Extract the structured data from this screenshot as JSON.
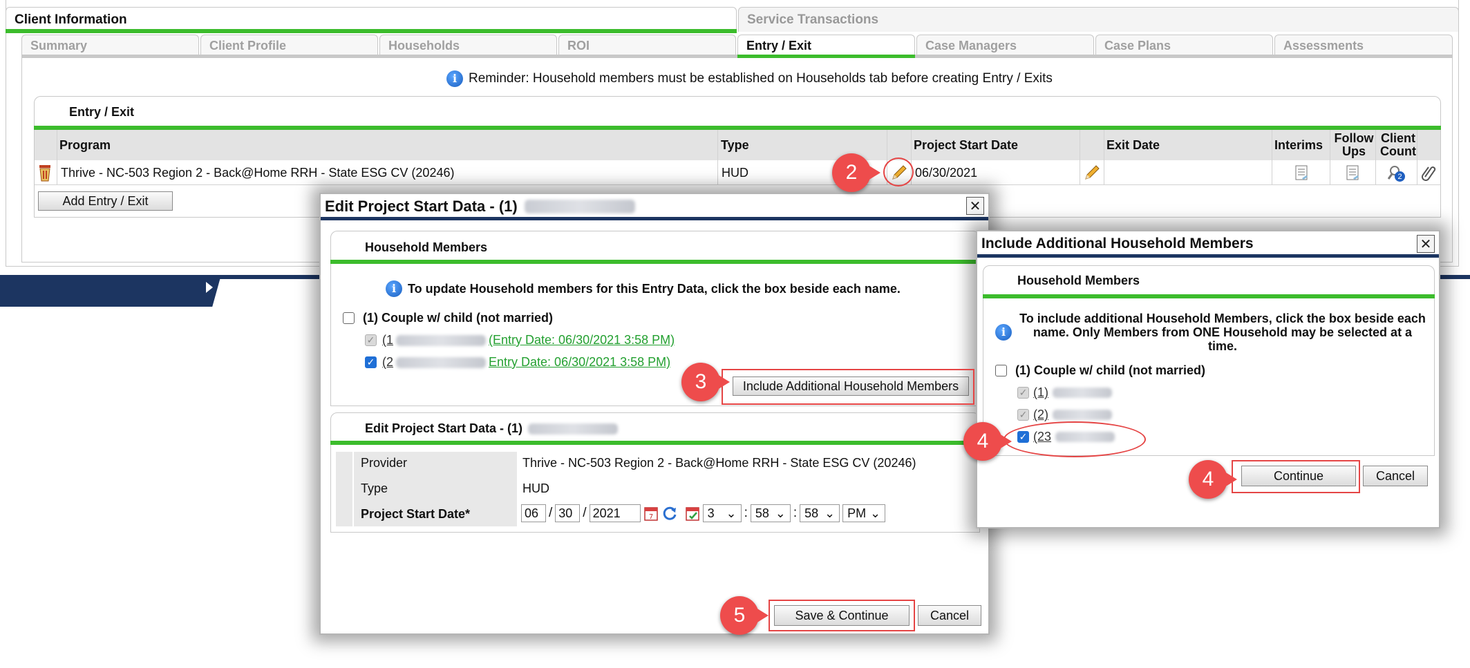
{
  "top_tabs": [
    "Client Information",
    "Service Transactions"
  ],
  "sub_tabs": [
    "Summary",
    "Client Profile",
    "Households",
    "ROI",
    "Entry / Exit",
    "Case Managers",
    "Case Plans",
    "Assessments"
  ],
  "reminder": "Reminder: Household members must be established on Households tab before creating Entry / Exits",
  "entry_exit_panel": {
    "title": "Entry / Exit",
    "columns": {
      "program": "Program",
      "type": "Type",
      "start": "Project Start Date",
      "exit": "Exit Date",
      "interims": "Interims",
      "follow_ups": "Follow Ups",
      "client_count": "Client Count"
    },
    "row": {
      "program": "Thrive - NC-503 Region 2 - Back@Home RRH - State ESG CV (20246)",
      "type": "HUD",
      "start": "06/30/2021",
      "exit": "",
      "client_count_badge": "2"
    },
    "add_button": "Add Entry / Exit"
  },
  "edit_dialog": {
    "title": "Edit Project Start Data - (1)",
    "close": "✕",
    "household_header": "Household Members",
    "household_info": "To update Household members for this Entry Data, click the box beside each name.",
    "household_group": "(1) Couple w/ child (not married)",
    "members": [
      {
        "prefix": "(1",
        "entry": "(Entry Date: 06/30/2021 3:58 PM)"
      },
      {
        "prefix": "(2",
        "entry": "Entry Date: 06/30/2021 3:58 PM)"
      }
    ],
    "include_button": "Include Additional Household Members",
    "section_title": "Edit Project Start Data - (1)",
    "fields": {
      "provider_label": "Provider",
      "provider_value": "Thrive - NC-503 Region 2 - Back@Home RRH - State ESG CV (20246)",
      "type_label": "Type",
      "type_value": "HUD",
      "start_label": "Project Start Date*",
      "month": "06",
      "day": "30",
      "year": "2021",
      "hour": "3",
      "minute": "58",
      "second": "58",
      "ampm": "PM",
      "sep_slash": "/",
      "sep_colon": ":"
    },
    "save_button": "Save & Continue",
    "cancel_button": "Cancel"
  },
  "include_dialog": {
    "title": "Include Additional Household Members",
    "close": "✕",
    "header": "Household Members",
    "info": "To include additional Household Members, click the box beside each name. Only Members from ONE Household may be selected at a time.",
    "group": "(1) Couple w/ child (not married)",
    "members": [
      "(1)",
      "(2)",
      "(23"
    ],
    "continue_button": "Continue",
    "cancel_button": "Cancel"
  },
  "callouts": {
    "c2": "2",
    "c3": "3",
    "c4a": "4",
    "c4b": "4",
    "c5": "5"
  },
  "colors": {
    "accent_green": "#3cbc2c",
    "navy": "#1c3561",
    "callout_red": "#ee4c4c",
    "link_green": "#23a030"
  }
}
